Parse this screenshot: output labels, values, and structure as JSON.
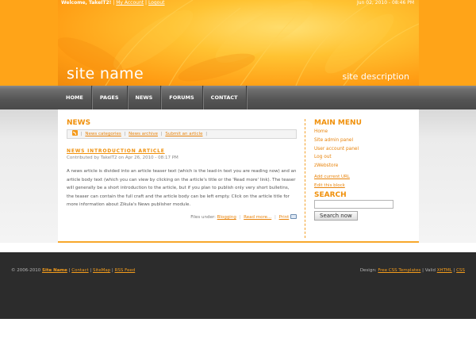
{
  "header": {
    "welcome": "Welcome, TakeIT2!",
    "my_account": "My Account",
    "logout": "Logout",
    "datetime": "Jun 02, 2010 - 08:46 PM",
    "site_name": "site name",
    "site_description": "site description"
  },
  "nav": {
    "items": [
      {
        "label": "HOME"
      },
      {
        "label": "PAGES"
      },
      {
        "label": "NEWS"
      },
      {
        "label": "FORUMS"
      },
      {
        "label": "CONTACT"
      }
    ]
  },
  "main": {
    "title": "NEWS",
    "links": {
      "categories": "News categories",
      "archive": "News archive",
      "submit": "Submit an article"
    },
    "article": {
      "title": "NEWS INTRODUCTION ARTICLE",
      "meta": "Contributed by TakeIT2 on Apr 26, 2010 - 08:17 PM",
      "body": "A news article is divided into an article teaser text (which is the lead-in text you are reading now) and an article body text (which you can view by clicking on the article's title or the 'Read more' link). The teaser will generally be a short introduction to the article, but if you plan to publish only very short bulletins, the teaser can contain the full craft and the article body can be left empty. Click on the article title for more information about Zikula's News publisher module.",
      "filed_under": "Files under:",
      "category": "Blogging",
      "read_more": "Read more...",
      "print": "Print"
    }
  },
  "sidebar": {
    "menu_title": "MAIN MENU",
    "menu_items": [
      {
        "label": "Home"
      },
      {
        "label": "Site admin panel"
      },
      {
        "label": "User account panel"
      },
      {
        "label": "Log out"
      },
      {
        "label": "zWebstore"
      }
    ],
    "extras": [
      {
        "label": "Add current URL"
      },
      {
        "label": "Edit this block"
      }
    ],
    "search_title": "SEARCH",
    "search_value": "",
    "search_button": "Search now"
  },
  "footer": {
    "copyright": "© 2006-2010",
    "site_name": "Site Name",
    "contact": "Contact",
    "sitemap": "SiteMap",
    "rss": "RSS Feed",
    "design_prefix": "Design:",
    "design_link": "Free CSS Templates",
    "valid": "Valid",
    "xhtml": "XHTML",
    "css": "CSS"
  }
}
